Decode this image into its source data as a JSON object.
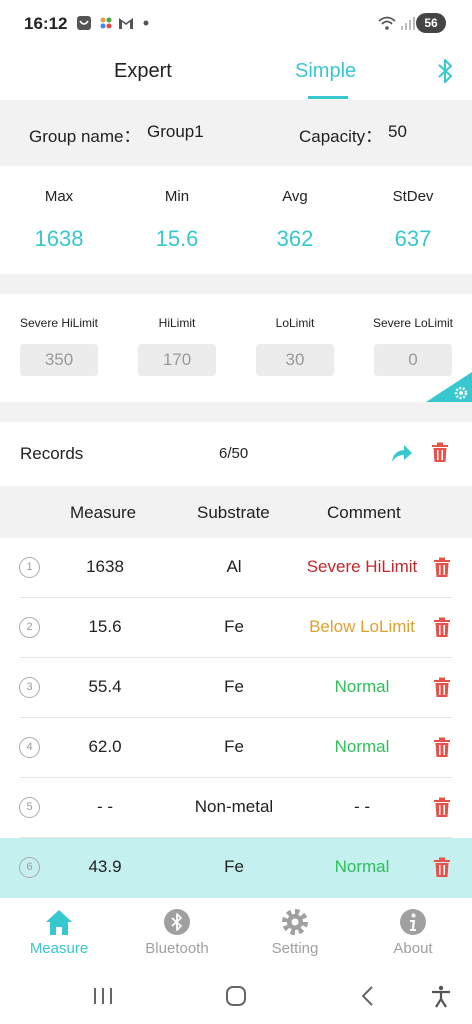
{
  "status_bar": {
    "time": "16:12",
    "battery": "56"
  },
  "tabs": {
    "expert": "Expert",
    "simple": "Simple"
  },
  "group": {
    "name_label": "Group name：",
    "name_value": "Group1",
    "capacity_label": "Capacity：",
    "capacity_value": "50"
  },
  "stats": [
    {
      "label": "Max",
      "value": "1638"
    },
    {
      "label": "Min",
      "value": "15.6"
    },
    {
      "label": "Avg",
      "value": "362"
    },
    {
      "label": "StDev",
      "value": "637"
    }
  ],
  "limits": [
    {
      "label": "Severe HiLimit",
      "value": "350"
    },
    {
      "label": "HiLimit",
      "value": "170"
    },
    {
      "label": "LoLimit",
      "value": "30"
    },
    {
      "label": "Severe LoLimit",
      "value": "0"
    }
  ],
  "records": {
    "title": "Records",
    "count": "6/50"
  },
  "table": {
    "headers": {
      "measure": "Measure",
      "substrate": "Substrate",
      "comment": "Comment"
    },
    "rows": [
      {
        "index": "1",
        "measure": "1638",
        "substrate": "Al",
        "comment": "Severe HiLimit",
        "comment_color": "#c0282d"
      },
      {
        "index": "2",
        "measure": "15.6",
        "substrate": "Fe",
        "comment": "Below LoLimit",
        "comment_color": "#e0a030"
      },
      {
        "index": "3",
        "measure": "55.4",
        "substrate": "Fe",
        "comment": "Normal",
        "comment_color": "#2ec05a"
      },
      {
        "index": "4",
        "measure": "62.0",
        "substrate": "Fe",
        "comment": "Normal",
        "comment_color": "#2ec05a"
      },
      {
        "index": "5",
        "measure": "- -",
        "substrate": "Non-metal",
        "comment": "- -",
        "comment_color": "#222222"
      },
      {
        "index": "6",
        "measure": "43.9",
        "substrate": "Fe",
        "comment": "Normal",
        "comment_color": "#2ec05a"
      }
    ]
  },
  "bottom_nav": [
    {
      "label": "Measure",
      "icon": "home-icon",
      "active": true
    },
    {
      "label": "Bluetooth",
      "icon": "bluetooth-icon",
      "active": false
    },
    {
      "label": "Setting",
      "icon": "gear-icon",
      "active": false
    },
    {
      "label": "About",
      "icon": "info-icon",
      "active": false
    }
  ],
  "colors": {
    "accent": "#37c8cf",
    "delete": "#e8504a",
    "selected_row": "#c4f0ef",
    "inactive": "#a0a0a0"
  }
}
